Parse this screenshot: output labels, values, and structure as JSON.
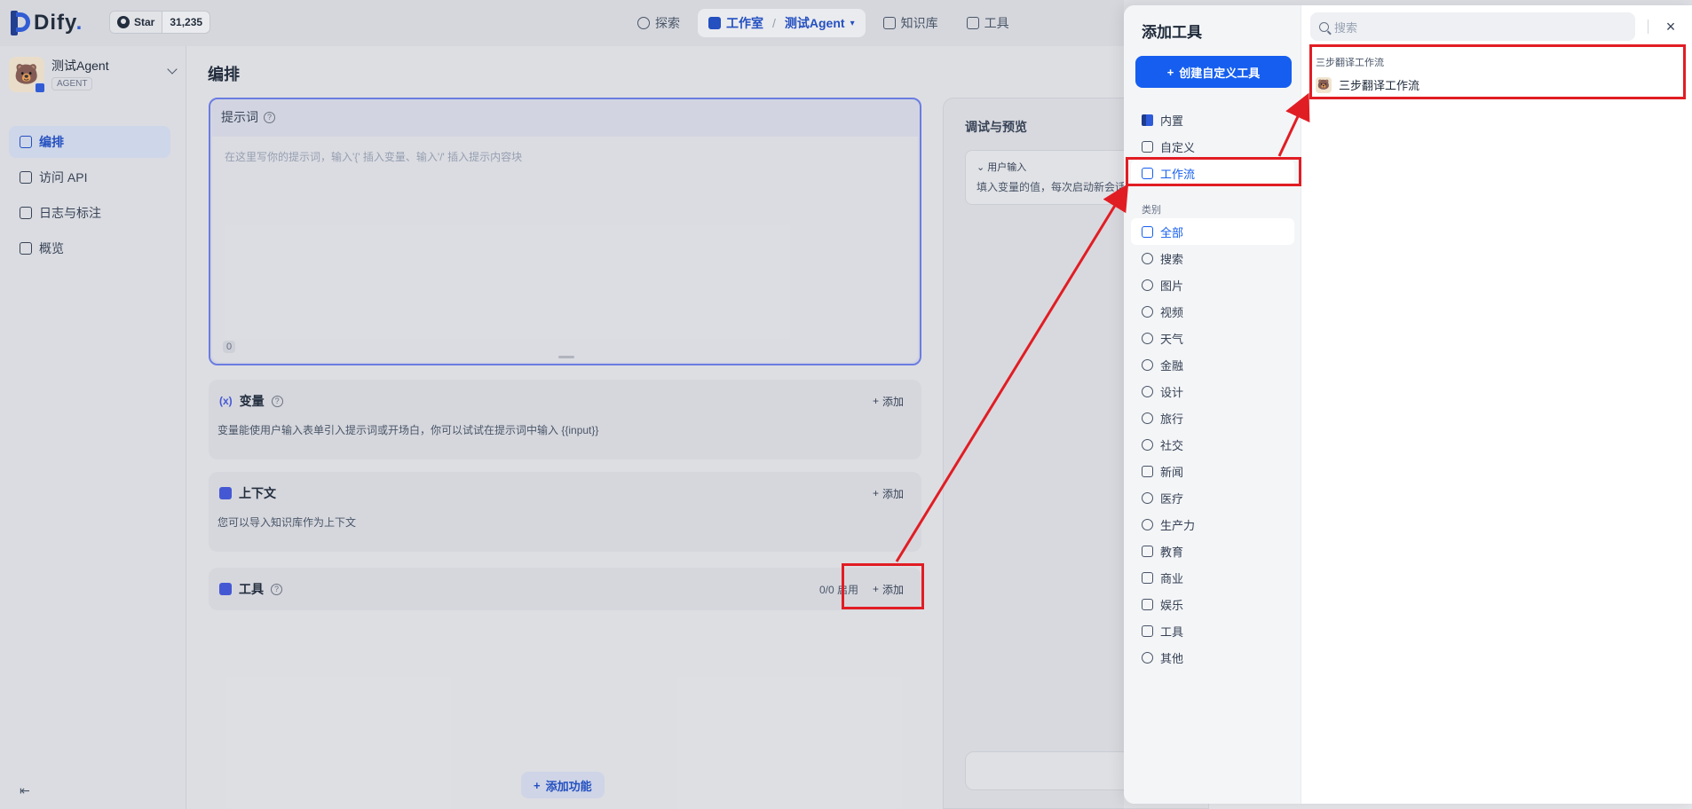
{
  "brand": {
    "name": "Dify",
    "github_label": "Star",
    "github_stars": "31,235"
  },
  "topnav": {
    "explore": "探索",
    "studio": "工作室",
    "current_app": "测试Agent",
    "datasets": "知识库",
    "tools": "工具"
  },
  "sidebar": {
    "app_name": "测试Agent",
    "app_type": "AGENT",
    "items": [
      {
        "label": "编排",
        "icon": "layout-icon",
        "active": true
      },
      {
        "label": "访问 API",
        "icon": "terminal-icon",
        "active": false
      },
      {
        "label": "日志与标注",
        "icon": "file-search-icon",
        "active": false
      },
      {
        "label": "概览",
        "icon": "bar-chart-icon",
        "active": false
      }
    ]
  },
  "main": {
    "title": "编排",
    "prompt": {
      "label": "提示词",
      "placeholder": "在这里写你的提示词，输入'{' 插入变量、输入'/' 插入提示内容块",
      "count": "0"
    },
    "variables": {
      "icon": "(x)",
      "title": "变量",
      "add": "添加",
      "desc": "变量能使用户输入表单引入提示词或开场白，你可以试试在提示词中输入 {{input}}"
    },
    "context": {
      "title": "上下文",
      "add": "添加",
      "desc": "您可以导入知识库作为上下文"
    },
    "tools": {
      "title": "工具",
      "status": "0/0 启用",
      "add": "添加"
    },
    "add_feature": "添加功能"
  },
  "debug": {
    "title": "调试与预览",
    "card_title": "用户输入",
    "card_desc": "填入变量的值，每次启动新会话"
  },
  "drawer": {
    "title": "添加工具",
    "create_button": "创建自定义工具",
    "types": [
      {
        "label": "内置",
        "icon": "dify-icon",
        "selected": false
      },
      {
        "label": "自定义",
        "icon": "code-icon",
        "selected": false
      },
      {
        "label": "工作流",
        "icon": "workflow-icon",
        "selected": true
      }
    ],
    "category_label": "类别",
    "categories": [
      {
        "label": "全部",
        "icon": "grid-icon",
        "selected": true
      },
      {
        "label": "搜索",
        "icon": "search-icon"
      },
      {
        "label": "图片",
        "icon": "image-icon"
      },
      {
        "label": "视频",
        "icon": "video-icon"
      },
      {
        "label": "天气",
        "icon": "cloud-icon"
      },
      {
        "label": "金融",
        "icon": "coin-icon"
      },
      {
        "label": "设计",
        "icon": "design-icon"
      },
      {
        "label": "旅行",
        "icon": "travel-icon"
      },
      {
        "label": "社交",
        "icon": "at-icon"
      },
      {
        "label": "新闻",
        "icon": "news-icon"
      },
      {
        "label": "医疗",
        "icon": "medical-icon"
      },
      {
        "label": "生产力",
        "icon": "lightbulb-icon"
      },
      {
        "label": "教育",
        "icon": "book-icon"
      },
      {
        "label": "商业",
        "icon": "briefcase-icon"
      },
      {
        "label": "娱乐",
        "icon": "gamepad-icon"
      },
      {
        "label": "工具",
        "icon": "hammer-icon"
      },
      {
        "label": "其他",
        "icon": "shapes-icon"
      }
    ],
    "search_placeholder": "搜索",
    "group_label": "三步翻译工作流",
    "tool_name": "三步翻译工作流",
    "annotation_color": "#e11d24",
    "accent_color": "#155eef"
  }
}
